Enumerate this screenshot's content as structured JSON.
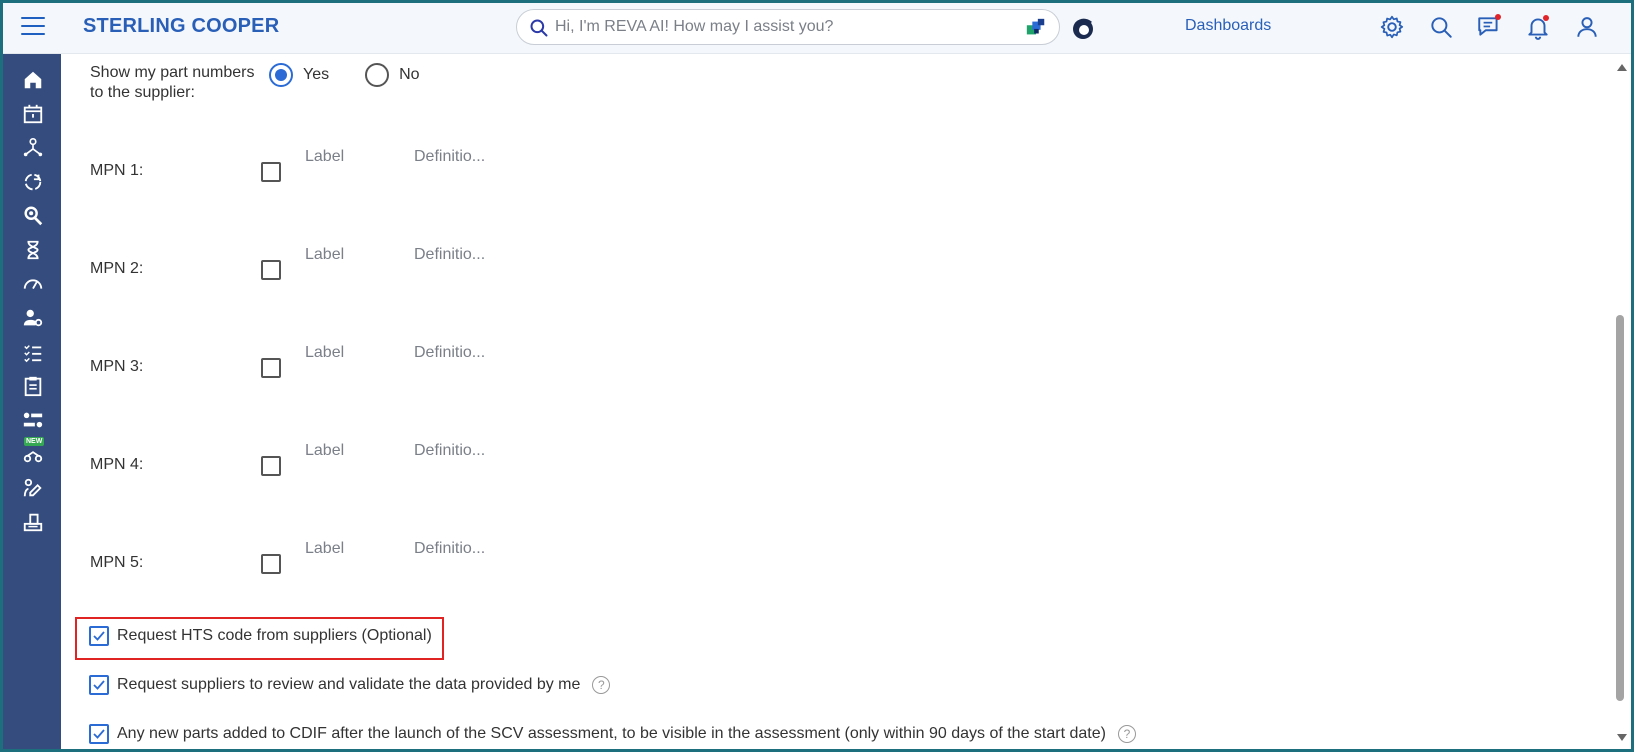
{
  "header": {
    "brand": "STERLING COOPER",
    "search_placeholder": "Hi, I'm REVA AI! How may I assist you?",
    "dashboards_label": "Dashboards",
    "icons": [
      "menu-icon",
      "search-icon",
      "ai-assist-icon",
      "reva-icon",
      "gear-icon",
      "search-icon",
      "chat-icon",
      "bell-icon",
      "user-icon"
    ],
    "notification_color": "#e0242a"
  },
  "sidebar": {
    "background": "#354d7e",
    "items": [
      "home-icon",
      "calendar-icon",
      "hierarchy-icon",
      "refresh-cycle-icon",
      "search-person-icon",
      "hourglass-icon",
      "gauge-icon",
      "user-settings-icon",
      "checklist-icon",
      "clipboard-icon",
      "transfer-icon",
      "new-feature-icon",
      "sign-icon",
      "podium-icon"
    ],
    "new_badge": "NEW"
  },
  "form": {
    "show_parts_label": "Show my part numbers to the supplier:",
    "show_parts_options": [
      {
        "label": "Yes",
        "checked": true
      },
      {
        "label": "No",
        "checked": false
      }
    ],
    "mpn_rows": [
      {
        "label": "MPN 1:",
        "label_placeholder": "Label",
        "definition_placeholder": "Definitio..."
      },
      {
        "label": "MPN 2:",
        "label_placeholder": "Label",
        "definition_placeholder": "Definitio..."
      },
      {
        "label": "MPN 3:",
        "label_placeholder": "Label",
        "definition_placeholder": "Definitio..."
      },
      {
        "label": "MPN 4:",
        "label_placeholder": "Label",
        "definition_placeholder": "Definitio..."
      },
      {
        "label": "MPN 5:",
        "label_placeholder": "Label",
        "definition_placeholder": "Definitio..."
      }
    ],
    "options": [
      {
        "label": "Request HTS code from suppliers (Optional)",
        "checked": true,
        "help": false
      },
      {
        "label": "Request suppliers to review and validate the data provided by me",
        "checked": true,
        "help": true
      },
      {
        "label": "Any new parts added to CDIF after the launch of the SCV assessment, to be visible in the assessment (only within 90 days of the start date)",
        "checked": true,
        "help": true
      }
    ],
    "help_glyph": "?"
  },
  "colors": {
    "accent": "#2a6bd6",
    "brand": "#2a5fb8",
    "highlight": "#e02424"
  }
}
